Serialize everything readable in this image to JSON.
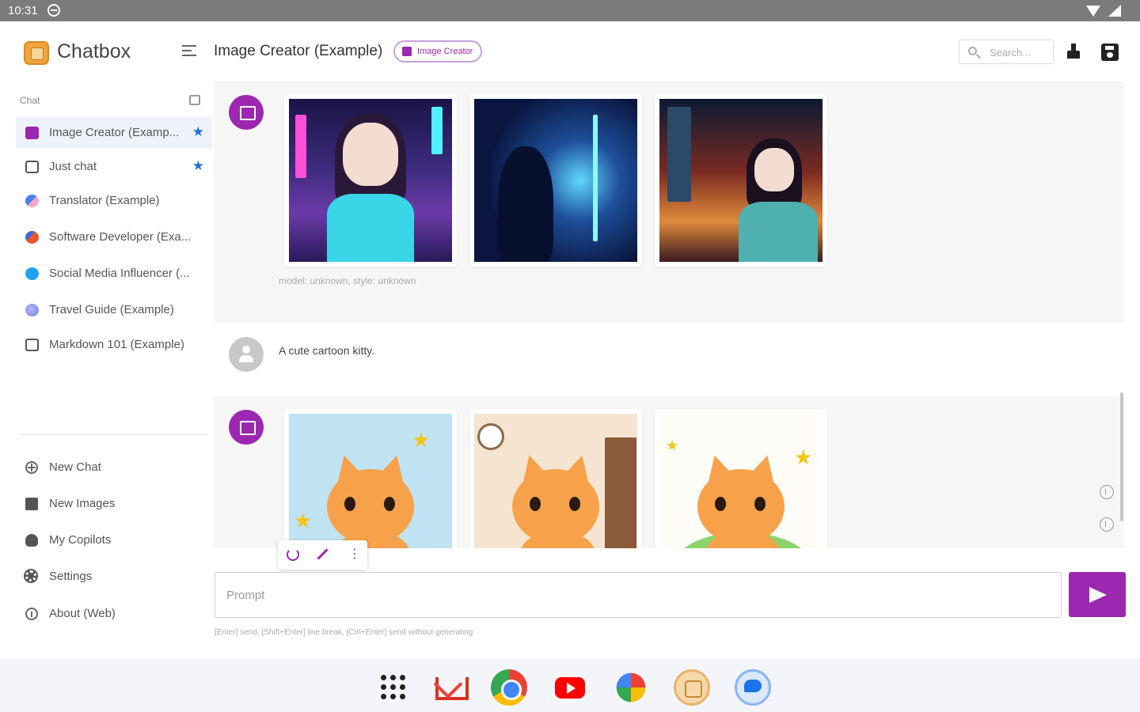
{
  "status_bar": {
    "time": "10:31"
  },
  "app": {
    "name": "Chatbox"
  },
  "header": {
    "chat_title": "Image Creator (Example)",
    "badge": "Image Creator",
    "search_placeholder": "Search..."
  },
  "sidebar": {
    "section_label": "Chat",
    "items": [
      {
        "label": "Image Creator (Examp...",
        "icon": "image-icon",
        "starred": true,
        "active": true
      },
      {
        "label": "Just chat",
        "icon": "chat-bubble-icon",
        "starred": true
      },
      {
        "label": "Translator (Example)",
        "icon": "translator-avatar"
      },
      {
        "label": "Software Developer (Exa...",
        "icon": "developer-avatar"
      },
      {
        "label": "Social Media Influencer (...",
        "icon": "twitter-avatar"
      },
      {
        "label": "Travel Guide (Example)",
        "icon": "travel-avatar"
      },
      {
        "label": "Markdown 101 (Example)",
        "icon": "chat-bubble-icon"
      }
    ],
    "actions": [
      {
        "label": "New Chat",
        "icon": "plus-circle-icon"
      },
      {
        "label": "New Images",
        "icon": "images-icon"
      },
      {
        "label": "My Copilots",
        "icon": "copilot-icon"
      },
      {
        "label": "Settings",
        "icon": "gear-icon"
      },
      {
        "label": "About (Web)",
        "icon": "info-icon"
      }
    ]
  },
  "messages": [
    {
      "role": "assistant",
      "type": "images",
      "images": [
        "anime girl in neon city",
        "anime girl in blue neon street",
        "anime girl in night city lights"
      ],
      "meta": "model: unknown, style: unknown"
    },
    {
      "role": "user",
      "text": "A cute cartoon kitty."
    },
    {
      "role": "assistant",
      "type": "images",
      "images": [
        "cartoon orange cat with stars",
        "cartoon orange cat with bow tie in room",
        "cartoon orange cat with bow tie and stars"
      ]
    }
  ],
  "input": {
    "placeholder": "Prompt",
    "hint": "[Enter] send, [Shift+Enter] line break, [Ctrl+Enter] send without generating"
  },
  "colors": {
    "accent": "#9c27b0",
    "star": "#1e6fd9"
  },
  "dock": [
    "app-launcher",
    "gmail",
    "chrome",
    "youtube",
    "google-photos",
    "chatbox",
    "messages"
  ]
}
